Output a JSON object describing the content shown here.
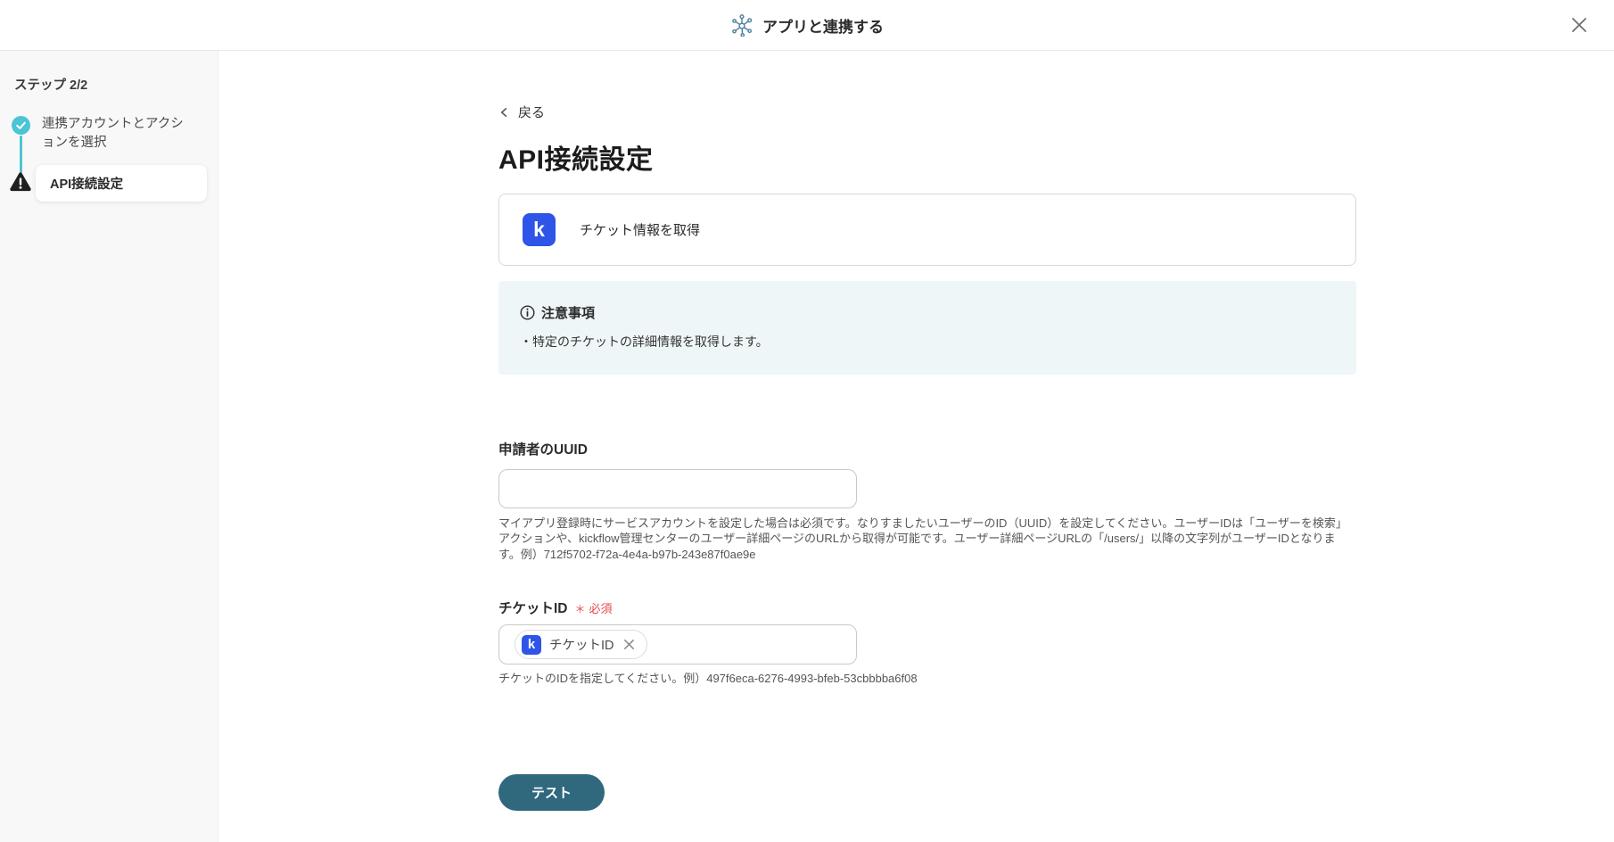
{
  "brand": {
    "logo_letter": "k"
  },
  "colors": {
    "accent_teal": "#4cc4d4",
    "kickflow_blue": "#2e54e8",
    "button_teal": "#30687e",
    "required_red": "#e5484d",
    "notice_bg": "#eff6f7",
    "header_icon_blue": "#4b7f9e"
  },
  "header": {
    "title": "アプリと連携する"
  },
  "sidebar": {
    "step_indicator": "ステップ 2/2",
    "steps": [
      {
        "label": "連携アカウントとアクションを選択",
        "status": "completed"
      },
      {
        "label": "API接続設定",
        "status": "active"
      }
    ]
  },
  "main": {
    "back_label": "戻る",
    "page_title": "API接続設定",
    "action_card": {
      "label": "チケット情報を取得"
    },
    "notice": {
      "title": "注意事項",
      "items": [
        "・特定のチケットの詳細情報を取得します。"
      ]
    },
    "uuid_field": {
      "label": "申請者のUUID",
      "value": "",
      "helper": "マイアプリ登録時にサービスアカウントを設定した場合は必須です。なりすましたいユーザーのID（UUID）を設定してください。ユーザーIDは「ユーザーを検索」アクションや、kickflow管理センターのユーザー詳細ページのURLから取得が可能です。ユーザー詳細ページURLの「/users/」以降の文字列がユーザーIDとなります。例）712f5702-f72a-4e4a-b97b-243e87f0ae9e"
    },
    "ticket_field": {
      "label": "チケットID",
      "required_mark": "＊",
      "required_label": "必須",
      "token": {
        "label": "チケットID"
      },
      "helper": "チケットのIDを指定してください。例）497f6eca-6276-4993-bfeb-53cbbbba6f08"
    },
    "test_button_label": "テスト"
  }
}
